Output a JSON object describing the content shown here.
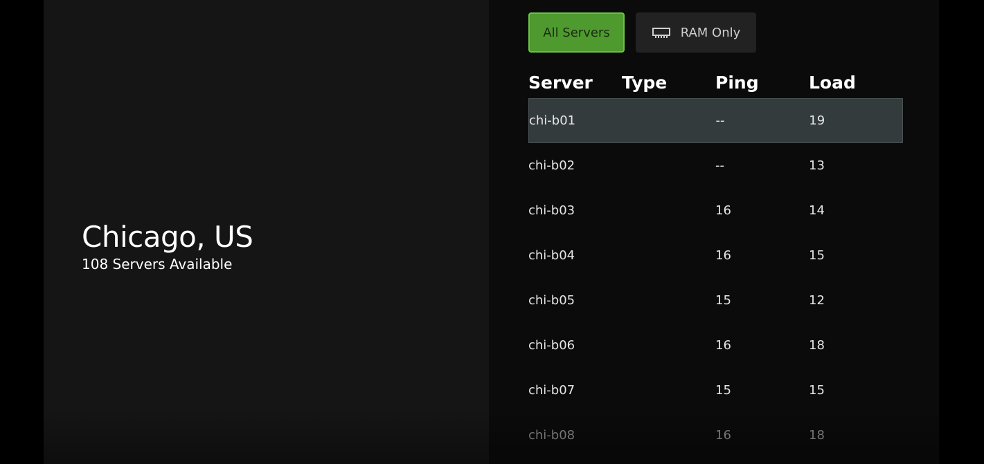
{
  "location": {
    "title": "Chicago, US",
    "subtitle": "108 Servers Available"
  },
  "filters": {
    "all_label": "All Servers",
    "ram_label": "RAM Only",
    "ram_icon": "memory-chip-icon",
    "active": "All Servers"
  },
  "colors": {
    "accent": "#4e9a2e",
    "selected_row": "#343b3d"
  },
  "table": {
    "headers": [
      "Server",
      "Type",
      "Ping",
      "Load"
    ],
    "rows": [
      {
        "server": "chi-b01",
        "type": "",
        "ping": "--",
        "load": "19"
      },
      {
        "server": "chi-b02",
        "type": "",
        "ping": "--",
        "load": "13"
      },
      {
        "server": "chi-b03",
        "type": "",
        "ping": "16",
        "load": "14"
      },
      {
        "server": "chi-b04",
        "type": "",
        "ping": "16",
        "load": "15"
      },
      {
        "server": "chi-b05",
        "type": "",
        "ping": "15",
        "load": "12"
      },
      {
        "server": "chi-b06",
        "type": "",
        "ping": "16",
        "load": "18"
      },
      {
        "server": "chi-b07",
        "type": "",
        "ping": "15",
        "load": "15"
      },
      {
        "server": "chi-b08",
        "type": "",
        "ping": "16",
        "load": "18"
      }
    ],
    "selected_index": 0
  }
}
